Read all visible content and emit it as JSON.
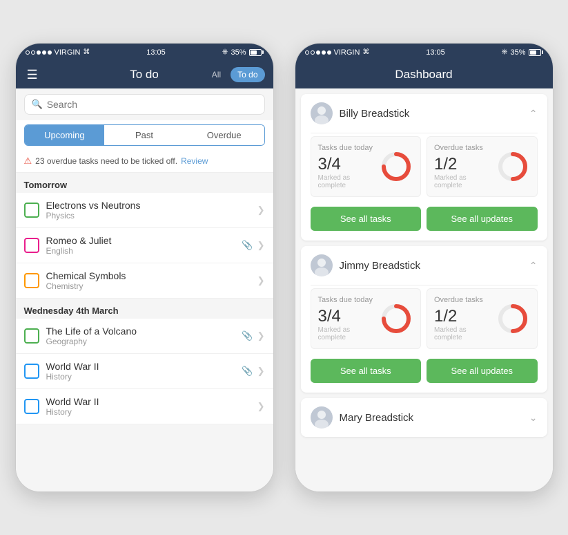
{
  "app": {
    "status_bar": {
      "carrier": "VIRGIN",
      "time": "13:05",
      "battery": "35%"
    }
  },
  "todo_screen": {
    "title": "To do",
    "tab_all": "All",
    "tab_todo": "To do",
    "search_placeholder": "Search",
    "filter_tabs": [
      "Upcoming",
      "Past",
      "Overdue"
    ],
    "active_filter": "Upcoming",
    "warning_text": "23 overdue tasks need to be ticked off.",
    "warning_link": "Review",
    "sections": [
      {
        "label": "Tomorrow",
        "tasks": [
          {
            "name": "Electrons vs Neutrons",
            "subject": "Physics",
            "color": "green",
            "has_pin": false
          },
          {
            "name": "Romeo & Juliet",
            "subject": "English",
            "color": "pink",
            "has_pin": true
          },
          {
            "name": "Chemical Symbols",
            "subject": "Chemistry",
            "color": "orange",
            "has_pin": false
          }
        ]
      },
      {
        "label": "Wednesday 4th March",
        "tasks": [
          {
            "name": "The Life of a Volcano",
            "subject": "Geography",
            "color": "green",
            "has_pin": true
          },
          {
            "name": "World War II",
            "subject": "History",
            "color": "blue",
            "has_pin": true
          },
          {
            "name": "World War II",
            "subject": "History",
            "color": "blue",
            "has_pin": false
          }
        ]
      }
    ]
  },
  "dashboard_screen": {
    "title": "Dashboard",
    "students": [
      {
        "name": "Billy Breadstick",
        "expanded": true,
        "tasks_due_label": "Tasks due today",
        "overdue_label": "Overdue tasks",
        "tasks_fraction": "3/4",
        "tasks_marked": "Marked as complete",
        "overdue_fraction": "1/2",
        "overdue_marked": "Marked as complete",
        "tasks_percent": 75,
        "overdue_percent": 50,
        "btn_tasks": "See all tasks",
        "btn_updates": "See all updates"
      },
      {
        "name": "Jimmy Breadstick",
        "expanded": true,
        "tasks_due_label": "Tasks due today",
        "overdue_label": "Overdue tasks",
        "tasks_fraction": "3/4",
        "tasks_marked": "Marked as complete",
        "overdue_fraction": "1/2",
        "overdue_marked": "Marked as complete",
        "tasks_percent": 75,
        "overdue_percent": 50,
        "btn_tasks": "See all tasks",
        "btn_updates": "See all updates"
      },
      {
        "name": "Mary Breadstick",
        "expanded": false
      }
    ]
  }
}
